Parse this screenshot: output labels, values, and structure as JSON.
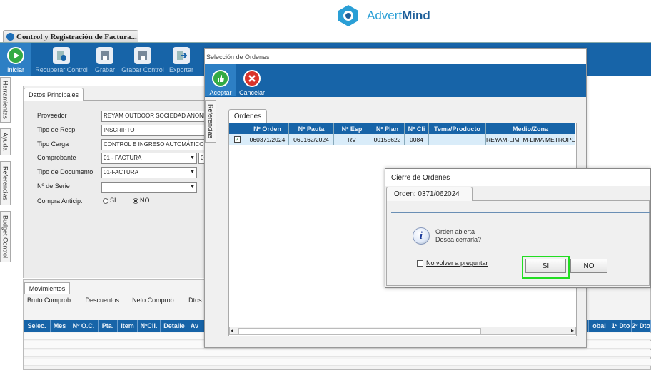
{
  "brand": {
    "name_a": "Advert",
    "name_b": "Mind"
  },
  "app_tab": {
    "label": "Control y Registración de Factura..."
  },
  "toolbar": {
    "items": [
      {
        "label": "Iniciar",
        "icon": "play-icon"
      },
      {
        "label": "Recuperar Control",
        "icon": "recover-icon"
      },
      {
        "label": "Grabar",
        "icon": "save-icon"
      },
      {
        "label": "Grabar Control",
        "icon": "save-control-icon"
      },
      {
        "label": "Exportar",
        "icon": "export-icon"
      }
    ]
  },
  "side_tabs": [
    "Herramientas",
    "Ayuda",
    "Referencias",
    "Budget Control"
  ],
  "datos": {
    "tab": "Datos Principales",
    "fields": [
      {
        "label": "Proveedor",
        "value": "REYAM OUTDOOR SOCIEDAD ANONIM"
      },
      {
        "label": "Tipo de Resp.",
        "value": "INSCRIPTO"
      },
      {
        "label": "Tipo Carga",
        "value": "CONTROL E INGRESO AUTOMÁTICO"
      },
      {
        "label": "Comprobante",
        "value": "01 - FACTURA",
        "extra": "0"
      },
      {
        "label": "Tipo de Documento",
        "value": "01-FACTURA"
      },
      {
        "label": "Nº de Serie",
        "value": ""
      }
    ],
    "compra": {
      "label": "Compra Anticip.",
      "si": "SI",
      "no": "NO"
    }
  },
  "movimientos": {
    "tab": "Movimientos",
    "headers": [
      "Bruto Comprob.",
      "Descuentos",
      "Neto Comprob.",
      "Dtos"
    ],
    "columns": [
      "Selec.",
      "Mes",
      "Nº O.C.",
      "Pta.",
      "Item",
      "NºCli.",
      "Detalle",
      "Av"
    ],
    "columns_right": [
      "obal",
      "1º Dto",
      "2º Dto"
    ]
  },
  "seleccion": {
    "title": "Selección de Ordenes",
    "buttons": [
      {
        "label": "Aceptar",
        "icon": "thumbs-up-icon"
      },
      {
        "label": "Cancelar",
        "icon": "cancel-icon"
      }
    ],
    "side_tab": "Referencias",
    "tab": "Ordenes",
    "columns": [
      "",
      "Nº Orden",
      "Nº Pauta",
      "Nº Esp",
      "Nº Plan",
      "Nº Cli",
      "Tema/Producto",
      "Medio/Zona"
    ],
    "rows": [
      {
        "checked": true,
        "orden": "060371/2024",
        "pauta": "060162/2024",
        "esp": "RV",
        "plan": "00155622",
        "cli": "0084",
        "tema": "",
        "medio": "REYAM-LIM_M-LIMA METROPO"
      }
    ]
  },
  "cierre": {
    "title": "Cierre de Ordenes",
    "tab": "Orden:  0371/062024",
    "message_1": "Orden abierta",
    "message_2": "Desea cerrarla?",
    "checkbox_label": "No volver a preguntar",
    "si": "SI",
    "no": "NO"
  },
  "colors": {
    "toolbar": "#1764a8",
    "highlight": "#22dd22"
  }
}
